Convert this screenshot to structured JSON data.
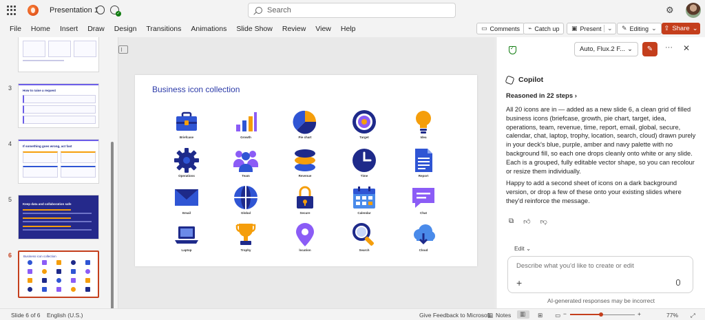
{
  "titlebar": {
    "doc_title": "Presentation 1",
    "search_placeholder": "Search"
  },
  "ribbon": {
    "tabs": [
      "File",
      "Home",
      "Insert",
      "Draw",
      "Design",
      "Transitions",
      "Animations",
      "Slide Show",
      "Review",
      "View",
      "Help"
    ],
    "comments": "Comments",
    "catch_up": "Catch up",
    "present": "Present",
    "editing": "Editing",
    "share": "Share"
  },
  "thumbnails": {
    "items": [
      {
        "number": "",
        "title": ""
      },
      {
        "number": "3",
        "title": "How to raise a request"
      },
      {
        "number": "4",
        "title": "If something goes wrong, act fast"
      },
      {
        "number": "5",
        "title": "Keep data and collaboration safe"
      },
      {
        "number": "6",
        "title": "Business icon collection"
      }
    ],
    "selected_index": 4
  },
  "slide": {
    "title": "Business icon collection",
    "icons": [
      {
        "label": "Briefcase",
        "icon": "briefcase-icon"
      },
      {
        "label": "Growth",
        "icon": "growth-icon"
      },
      {
        "label": "Pie chart",
        "icon": "pie-chart-icon"
      },
      {
        "label": "Target",
        "icon": "target-icon"
      },
      {
        "label": "Idea",
        "icon": "idea-icon"
      },
      {
        "label": "Operations",
        "icon": "operations-icon"
      },
      {
        "label": "Team",
        "icon": "team-icon"
      },
      {
        "label": "Revenue",
        "icon": "revenue-icon"
      },
      {
        "label": "Time",
        "icon": "time-icon"
      },
      {
        "label": "Report",
        "icon": "report-icon"
      },
      {
        "label": "Email",
        "icon": "email-icon"
      },
      {
        "label": "Global",
        "icon": "global-icon"
      },
      {
        "label": "Secure",
        "icon": "secure-icon"
      },
      {
        "label": "Calendar",
        "icon": "calendar-icon"
      },
      {
        "label": "Chat",
        "icon": "chat-icon"
      },
      {
        "label": "Laptop",
        "icon": "laptop-icon"
      },
      {
        "label": "Trophy",
        "icon": "trophy-icon"
      },
      {
        "label": "location",
        "icon": "location-icon"
      },
      {
        "label": "Search",
        "icon": "search-icon"
      },
      {
        "label": "Cloud",
        "icon": "cloud-icon"
      }
    ],
    "colors": {
      "navy": "#1e2a8a",
      "blue": "#2f55d4",
      "purple": "#8b5cf6",
      "amber": "#f59e0b"
    }
  },
  "copilot": {
    "model": "Auto, Flux.2 F...",
    "title": "Copilot",
    "reasoned": "Reasoned in 22 steps",
    "paragraph1": "All 20 icons are in — added as a new slide 6, a clean grid of filled business icons (briefcase, growth, pie chart, target, idea, operations, team, revenue, time, report, email, global, secure, calendar, chat, laptop, trophy, location, search, cloud) drawn purely in your deck's blue, purple, amber and navy palette with no background fill, so each one drops cleanly onto white or any slide. Each is a grouped, fully editable vector shape, so you can recolour or resize them individually.",
    "paragraph2": "Happy to add a second sheet of icons on a dark background version, or drop a few of these onto your existing slides where they'd reinforce the message.",
    "edit_mode": "Edit",
    "compose_placeholder": "Describe what you'd like to create or edit",
    "disclaimer": "AI-generated responses may be incorrect"
  },
  "status": {
    "slide_count": "Slide 6 of 6",
    "language": "English (U.S.)",
    "feedback": "Give Feedback to Microsoft",
    "notes": "Notes",
    "zoom": "77%"
  }
}
